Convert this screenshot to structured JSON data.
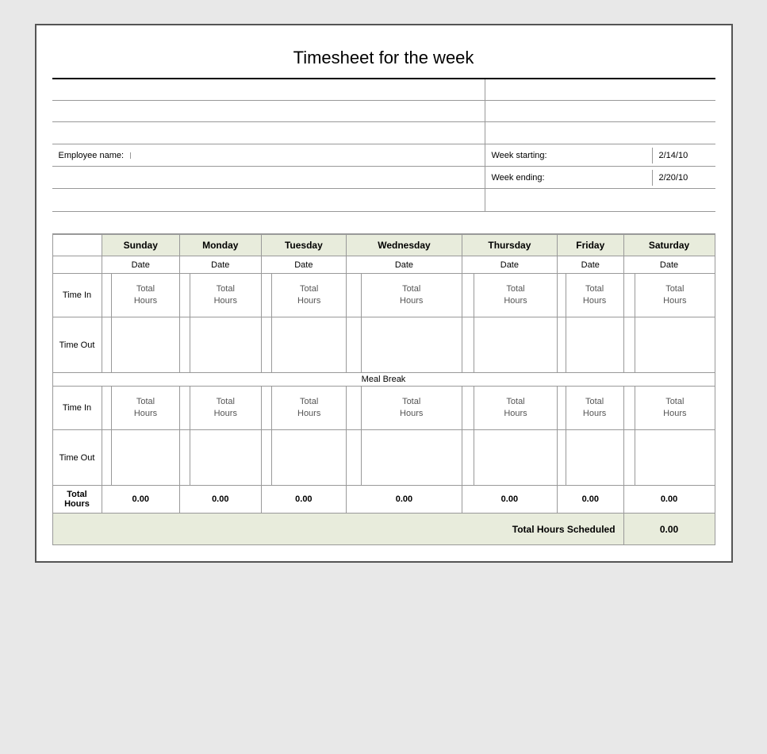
{
  "title": "Timesheet for the week",
  "employee_label": "Employee name:",
  "week_starting_label": "Week starting:",
  "week_starting_value": "2/14/10",
  "week_ending_label": "Week ending:",
  "week_ending_value": "2/20/10",
  "days": [
    "Sunday",
    "Monday",
    "Tuesday",
    "Wednesday",
    "Thursday",
    "Friday",
    "Saturday"
  ],
  "date_label": "Date",
  "time_in_label": "Time In",
  "time_out_label": "Time Out",
  "total_hours_label": "Total Hours",
  "hours_label": "Hours",
  "meal_break_label": "Meal Break",
  "total_hours_row_label": "Total Hours",
  "total_scheduled_label": "Total Hours Scheduled",
  "zero": "0.00"
}
